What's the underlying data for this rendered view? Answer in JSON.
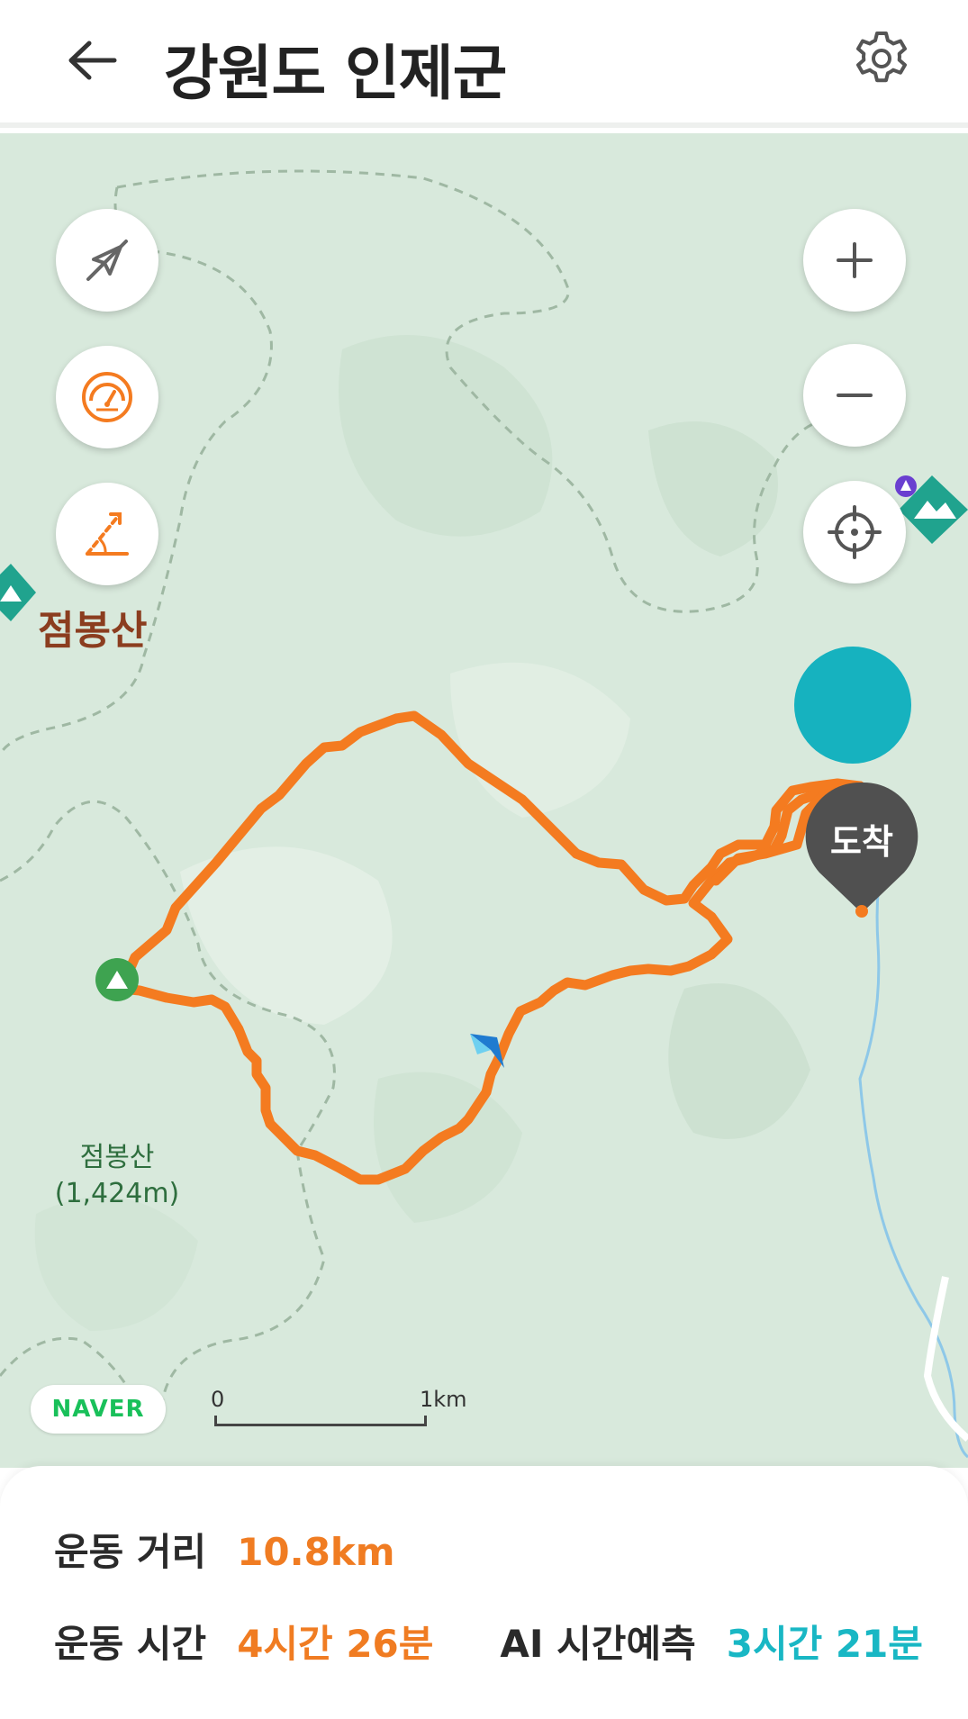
{
  "header": {
    "title": "강원도 인제군"
  },
  "map": {
    "peak_name": "점봉산",
    "peak_elevation": "(1,424m)",
    "top_label": "점봉산",
    "arrive_label": "도착",
    "provider": "NAVER",
    "scale_start": "0",
    "scale_end": "1km"
  },
  "stats": {
    "distance_label": "운동 거리",
    "distance_value": "10.8km",
    "time_label": "운동 시간",
    "time_value": "4시간 26분",
    "ai_label": "AI 시간예측",
    "ai_value": "3시간 21분"
  },
  "colors": {
    "route": "#f47b20",
    "accent_orange": "#f07c22",
    "accent_teal": "#19b7c4",
    "map_green": "#d9eadd"
  },
  "icons": {
    "back": "arrow-left",
    "settings": "gear",
    "compass_off": "compass-slash",
    "speedometer": "gauge",
    "slope": "slope-angle",
    "zoom_in": "plus",
    "zoom_out": "minus",
    "locate": "crosshair"
  }
}
